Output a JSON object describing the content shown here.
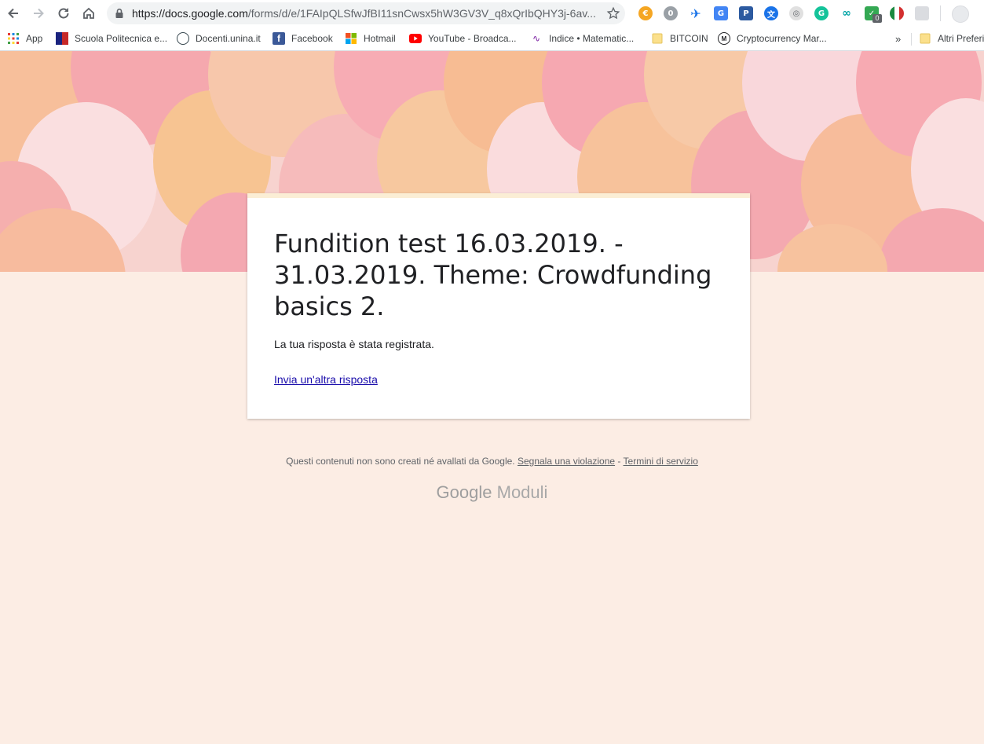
{
  "browser": {
    "url_host": "https://docs.google.com",
    "url_path": "/forms/d/e/1FAIpQLSfwJfBI11snCwsx5hW3GV3V_q8xQrIbQHY3j-6av...",
    "extension_badge": "0"
  },
  "bookmarks": {
    "items": [
      {
        "label": "App",
        "icon": "apps-grid-icon"
      },
      {
        "label": "Scuola Politecnica e...",
        "icon": "politecnica-flag-icon"
      },
      {
        "label": "Docenti.unina.it",
        "icon": "unina-logo-icon"
      },
      {
        "label": "Facebook",
        "icon": "facebook-icon"
      },
      {
        "label": "Hotmail",
        "icon": "microsoft-icon"
      },
      {
        "label": "YouTube - Broadca...",
        "icon": "youtube-icon"
      },
      {
        "label": "Indice • Matematic...",
        "icon": "matematica-icon"
      },
      {
        "label": "BITCOIN",
        "icon": "folder-icon"
      },
      {
        "label": "Cryptocurrency Mar...",
        "icon": "coinmarketcap-icon"
      }
    ],
    "overflow": "»",
    "other": "Altri Preferiti"
  },
  "form": {
    "title": "Fundition test 16.03.2019. - 31.03.2019. Theme: Crowdfunding basics 2.",
    "confirmation": "La tua risposta è stata registrata.",
    "another_response": "Invia un'altra risposta"
  },
  "footer": {
    "disclaimer": "Questi contenuti non sono creati né avallati da Google.",
    "report": "Segnala una violazione",
    "separator": " - ",
    "terms": "Termini di servizio",
    "brand_google": "Google",
    "brand_product": "Moduli"
  },
  "colors": {
    "page_bg": "#fcede4",
    "card_accent": "#fbeed5",
    "link": "#1a0dab"
  }
}
